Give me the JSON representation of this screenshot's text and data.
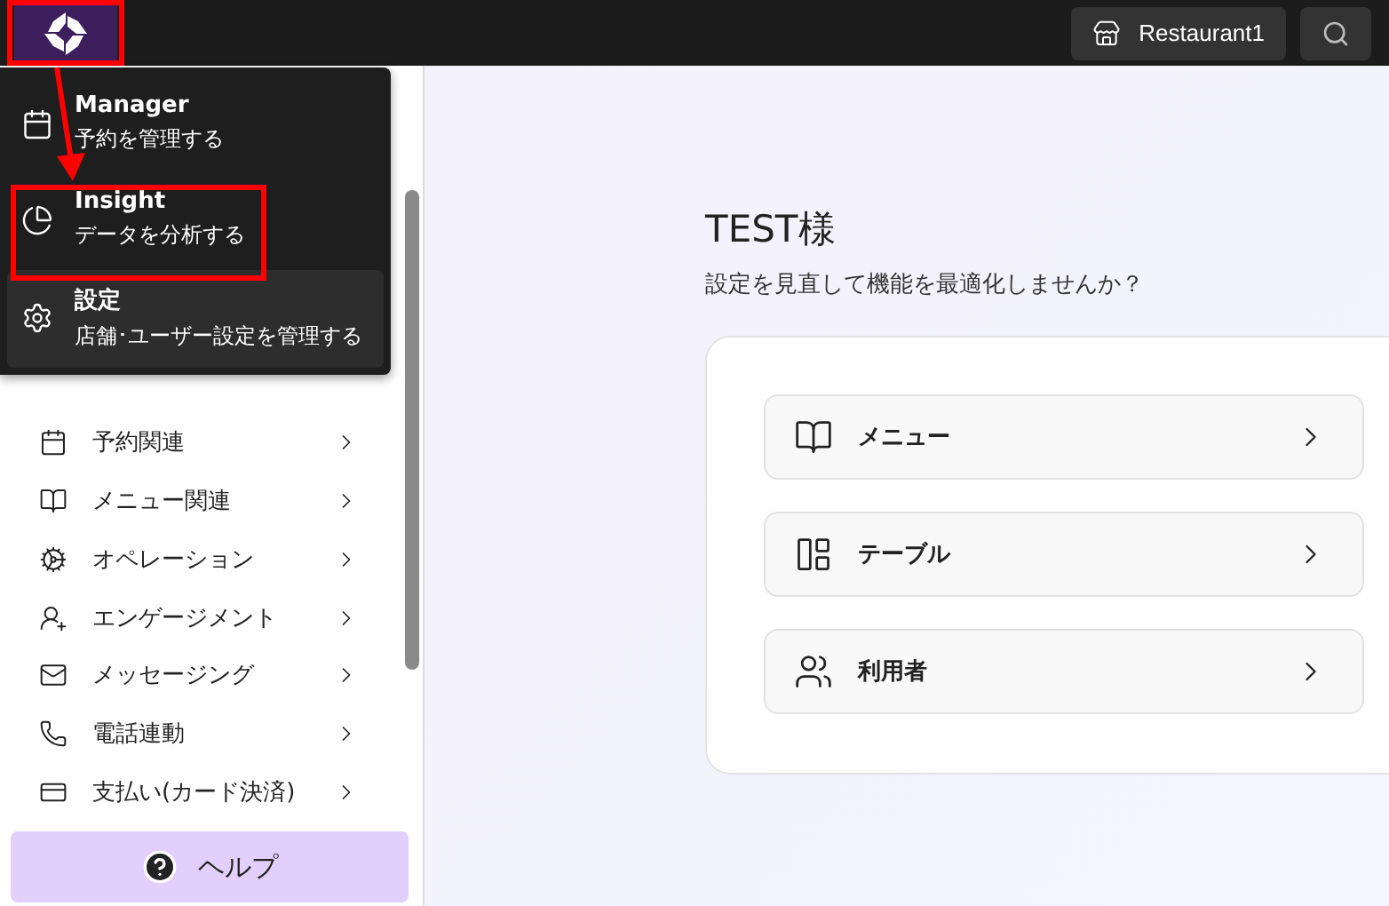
{
  "top_bar": {
    "store": "Restaurant1"
  },
  "app_menu": [
    {
      "kind": "calendar",
      "title": "Manager",
      "subtitle": "予約を管理する",
      "selected": false
    },
    {
      "kind": "chart",
      "title": "Insight",
      "subtitle": "データを分析する",
      "selected": false
    },
    {
      "kind": "gear",
      "title": "設定",
      "subtitle": "店舗･ユーザー設定を管理する",
      "selected": true
    }
  ],
  "sidebar": {
    "items": [
      {
        "kind": "calendar",
        "label": "予約関連"
      },
      {
        "kind": "book",
        "label": "メニュー関連"
      },
      {
        "kind": "gear",
        "label": "オペレーション"
      },
      {
        "kind": "people",
        "label": "エンゲージメント"
      },
      {
        "kind": "mail",
        "label": "メッセージング"
      },
      {
        "kind": "phone",
        "label": "電話連動"
      },
      {
        "kind": "card",
        "label": "支払い(カード決済)"
      }
    ],
    "help": "ヘルプ"
  },
  "main": {
    "greeting": "TEST様",
    "subtitle": "設定を見直して機能を最適化しませんか？",
    "cards": [
      {
        "kind": "book",
        "label": "メニュー"
      },
      {
        "kind": "table",
        "label": "テーブル"
      },
      {
        "kind": "users",
        "label": "利用者"
      }
    ]
  }
}
